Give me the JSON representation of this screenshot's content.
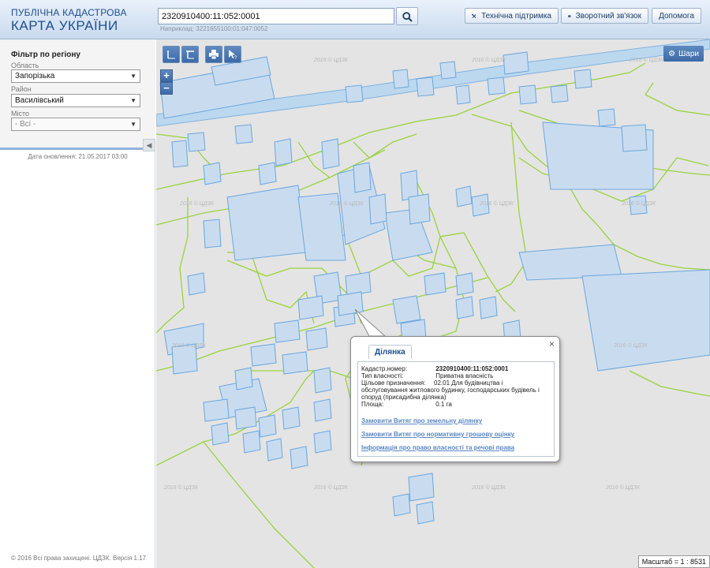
{
  "header": {
    "logo_line1": "ПУБЛІЧНА КАДАСТРОВА",
    "logo_line2": "КАРТА УКРАЇНИ",
    "search_value": "2320910400:11:052:0001",
    "example": "Наприклад: 3221655100:01:047:0052",
    "support_label": "Технічна підтримка",
    "feedback_label": "Зворотний зв'язок",
    "help_label": "Допомога"
  },
  "sidebar": {
    "title": "Фільтр по регіону",
    "oblast_label": "Область",
    "oblast_value": "Запорізька",
    "rayon_label": "Район",
    "rayon_value": "Василівський",
    "misto_label": "Місто",
    "misto_value": "- Всі -",
    "collapse_glyph": "◀",
    "update_text": "Дата оновлення: 21.05.2017 03:00",
    "copyright": "© 2016 Всі права захищені. ЦДЗК. Версія 1.17"
  },
  "map": {
    "layers_label": "Шари",
    "zoom_in": "+",
    "zoom_out": "−",
    "scale_text": "Масштаб = 1 : 8531",
    "watermark": "2016 © ЦДЗК",
    "colors": {
      "background": "#e4e4e4",
      "parcel_fill": "#c9dcef",
      "parcel_stroke": "#6aa6df",
      "boundary": "#9ad23d",
      "road": "#bcd8ef"
    }
  },
  "popup": {
    "tab_label": "Ділянка",
    "close_glyph": "×",
    "cad_label": "Кадастр.номер:",
    "cad_value": "2320910400:11:052:0001",
    "own_label": "Тип власності:",
    "own_value": "Приватна власність",
    "purpose_label": "Цільове призначення:",
    "purpose_value": "02.01 Для будівництва і обслуговування житлового будинку, господарських будівель і споруд (присадибна ділянка)",
    "area_label": "Площа:",
    "area_value": "0.1 га",
    "link1": "Замовити Витяг про земельну ділянку",
    "link2": "Замовити Витяг про нормативну грошову оцінку",
    "link3": "Інформація про право власності та речові права"
  }
}
